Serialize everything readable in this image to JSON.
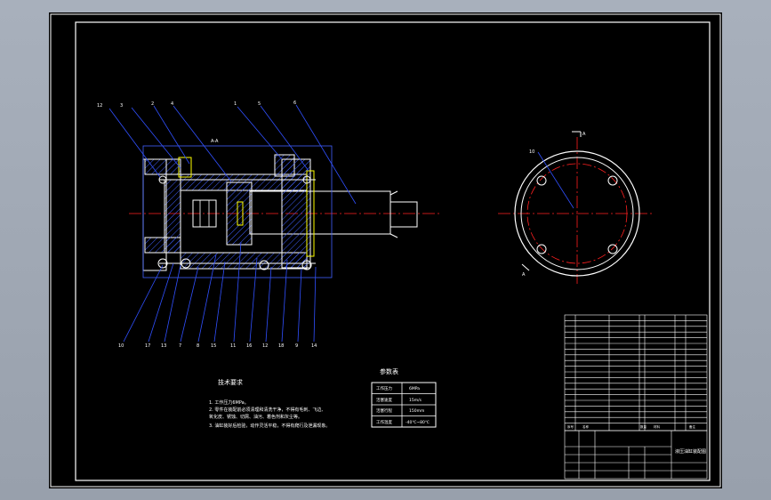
{
  "section_label": "A-A",
  "view_label_side": "A",
  "view_label_bottom": "A",
  "balloon_labels_top": [
    "12",
    "3",
    "2",
    "4",
    "1",
    "5",
    "6"
  ],
  "balloon_labels_bottom": [
    "10",
    "17",
    "13",
    "7",
    "8",
    "15",
    "11",
    "16",
    "12",
    "18",
    "9",
    "14"
  ],
  "tech_requirements": {
    "title": "技术要求",
    "lines": [
      "1. 工作压力6MPa。",
      "2. 零件在装配前必须清理和清洗干净，不得有毛刺、飞边、",
      "   氧化皮、锈蚀、切屑、油污、着色剂和灰尘等。",
      "3. 油缸装好后检验，动作灵活平稳，不得有爬行及泄漏现象。"
    ]
  },
  "param_table": {
    "title": "参数表",
    "rows": [
      [
        "工作压力",
        "6MPa"
      ],
      [
        "活塞速度",
        "15m/s"
      ],
      [
        "活塞行程",
        "150mm"
      ],
      [
        "工作温度",
        "-40℃~80℃"
      ]
    ]
  },
  "title_block": {
    "drawing_name": "液压油缸装配图",
    "header_cells": [
      "序号",
      "名称",
      "数量",
      "材料",
      "备注"
    ]
  },
  "colors": {
    "background": "#000000",
    "outline": "#ffffff",
    "hatch": "#4060ff",
    "centerline": "#ff2020",
    "part": "#ffff00",
    "leader": "#3050ff"
  }
}
